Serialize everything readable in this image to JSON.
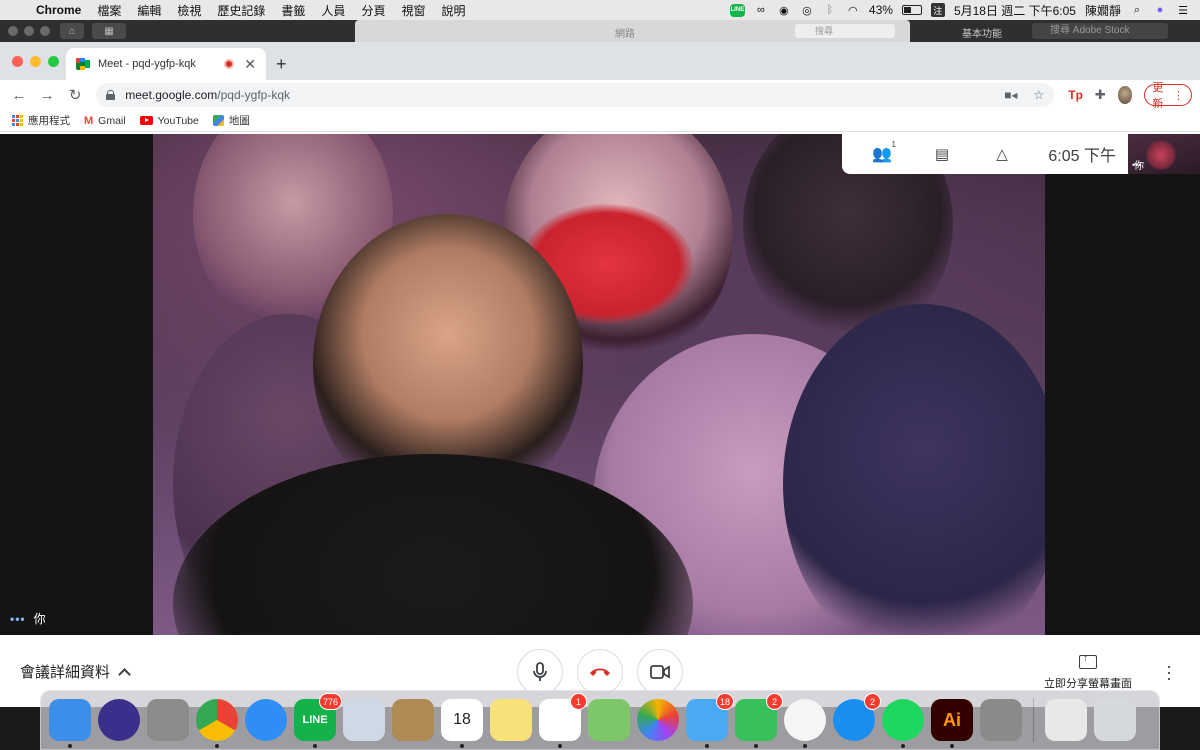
{
  "menubar": {
    "app_name": "Chrome",
    "menus": [
      "檔案",
      "編輯",
      "檢視",
      "歷史記錄",
      "書籤",
      "人員",
      "分頁",
      "視窗",
      "說明"
    ],
    "battery": "43%",
    "datetime": "5月18日 週二 下午6:05",
    "user": "陳嫺靜"
  },
  "background_window": {
    "title": "網路",
    "search_placeholder": "搜尋",
    "right_label": "基本功能",
    "stock_placeholder": "搜尋 Adobe Stock"
  },
  "browser": {
    "tab_title": "Meet - pqd-ygfp-kqk",
    "url_host": "meet.google.com",
    "url_path": "/pqd-ygfp-kqk",
    "update_label": "更新",
    "bookmarks": [
      {
        "label": "應用程式",
        "icon": "apps-grid-icon"
      },
      {
        "label": "Gmail",
        "icon": "gmail-icon"
      },
      {
        "label": "YouTube",
        "icon": "youtube-icon"
      },
      {
        "label": "地圖",
        "icon": "maps-icon"
      }
    ]
  },
  "meet": {
    "participants_count": "1",
    "clock": "6:05 下午",
    "self_label": "你",
    "thumb_label": "你",
    "details_label": "會議詳細資料",
    "share_label": "立即分享螢幕畫面"
  },
  "dock": {
    "apps": [
      {
        "name": "finder",
        "label": "",
        "badge": "",
        "color": "#3c8ee8"
      },
      {
        "name": "siri",
        "label": "",
        "badge": "",
        "color": "#3a2f8a"
      },
      {
        "name": "launchpad",
        "label": "",
        "badge": "",
        "color": "#8c8c8c"
      },
      {
        "name": "chrome",
        "label": "",
        "badge": "",
        "color": "#ffffff"
      },
      {
        "name": "safari",
        "label": "",
        "badge": "",
        "color": "#2f8ef5"
      },
      {
        "name": "line",
        "label": "LINE",
        "badge": "776",
        "color": "#13b24a"
      },
      {
        "name": "mail",
        "label": "",
        "badge": "",
        "color": "#cfd8e6"
      },
      {
        "name": "contacts",
        "label": "",
        "badge": "",
        "color": "#b08a55"
      },
      {
        "name": "calendar",
        "label": "18",
        "badge": "",
        "color": "#ffffff"
      },
      {
        "name": "notes",
        "label": "",
        "badge": "",
        "color": "#f7e27a"
      },
      {
        "name": "reminders",
        "label": "",
        "badge": "1",
        "color": "#ffffff"
      },
      {
        "name": "maps",
        "label": "",
        "badge": "",
        "color": "#7dc76a"
      },
      {
        "name": "photos",
        "label": "",
        "badge": "",
        "color": "#ffffff"
      },
      {
        "name": "messages",
        "label": "",
        "badge": "18",
        "color": "#4aa8f5"
      },
      {
        "name": "facetime",
        "label": "",
        "badge": "2",
        "color": "#38c05c"
      },
      {
        "name": "music",
        "label": "",
        "badge": "",
        "color": "#f5f5f5"
      },
      {
        "name": "app-store",
        "label": "",
        "badge": "2",
        "color": "#1a8ef0"
      },
      {
        "name": "spotify",
        "label": "",
        "badge": "",
        "color": "#1ed760"
      },
      {
        "name": "illustrator",
        "label": "Ai",
        "badge": "",
        "color": "#330000"
      },
      {
        "name": "system-preferences",
        "label": "",
        "badge": "",
        "color": "#8a8a8a"
      },
      {
        "name": "itunes-doc",
        "label": "",
        "badge": "",
        "color": "#e8e8e8"
      },
      {
        "name": "trash",
        "label": "",
        "badge": "",
        "color": "#d6d9dc"
      }
    ]
  },
  "colors": {
    "meet_red": "#d93025",
    "chrome_tabbar": "#dee1e6",
    "update_red": "#d93025"
  }
}
